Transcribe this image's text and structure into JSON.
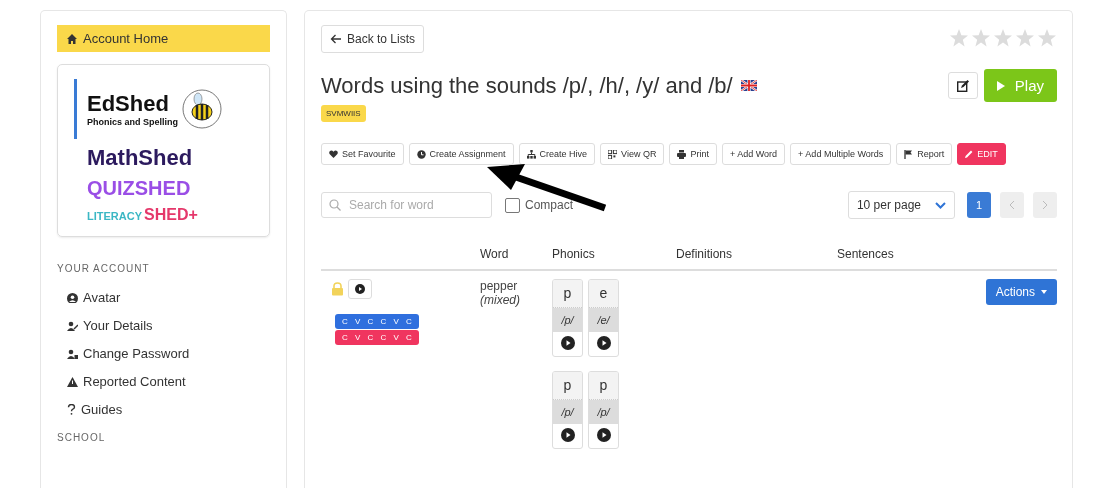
{
  "sidebar": {
    "home": {
      "label": "Account Home",
      "selected": true
    },
    "logos": [
      {
        "kind": "edshed",
        "title": "EdShed",
        "subtitle": "Phonics and Spelling",
        "selected": true
      },
      {
        "kind": "mathshed",
        "title": "MathShed",
        "selected": false
      },
      {
        "kind": "quizshed",
        "title": "QUIZSHED",
        "selected": false
      },
      {
        "kind": "literacy",
        "title": "LITERACY",
        "extra": "SHED+",
        "selected": false
      }
    ],
    "sections": [
      {
        "heading": "YOUR ACCOUNT",
        "items": [
          {
            "label": "Avatar"
          },
          {
            "label": "Your Details"
          },
          {
            "label": "Change Password"
          },
          {
            "label": "Reported Content"
          },
          {
            "label": "Guides"
          }
        ]
      },
      {
        "heading": "SCHOOL"
      }
    ]
  },
  "main": {
    "back_button": "Back to Lists",
    "stars": 0,
    "title": "Words using the sounds /p/, /h/, /y/ and /b/",
    "code": "SVMWIIS",
    "play_button": "Play",
    "toolbar": [
      {
        "label": "Set Favourite",
        "kind": "plain"
      },
      {
        "label": "Create Assignment",
        "kind": "plain"
      },
      {
        "label": "Create Hive",
        "kind": "plain"
      },
      {
        "label": "View QR",
        "kind": "plain"
      },
      {
        "label": "Print",
        "kind": "plain"
      },
      {
        "label": "+ Add Word",
        "kind": "plain"
      },
      {
        "label": "+ Add Multiple Words",
        "kind": "plain"
      },
      {
        "label": "Report",
        "kind": "plain"
      },
      {
        "label": "EDIT",
        "kind": "danger"
      }
    ],
    "search": {
      "placeholder": "Search for word"
    },
    "compact": {
      "label": "Compact",
      "checked": false
    },
    "per_page": "10 per page",
    "pagination": {
      "pages": [
        {
          "label": "1",
          "selected": true
        }
      ],
      "prev_disabled": true,
      "next_disabled": true
    },
    "table": {
      "columns": [
        "Word",
        "Phonics",
        "Definitions",
        "Sentences"
      ],
      "rows": [
        {
          "word": "pepper",
          "note": "(mixed)",
          "actions": "Actions",
          "patterns": [
            {
              "text": "C V C C V C",
              "color": "#2f6fde"
            },
            {
              "text": "C V C C V C",
              "color": "#f0355f"
            }
          ],
          "spellings": [
            [
              {
                "grapheme": "p",
                "phoneme": "/p/"
              },
              {
                "grapheme": "e",
                "phoneme": "/e/"
              }
            ],
            [
              {
                "grapheme": "p",
                "phoneme": "/p/"
              },
              {
                "grapheme": "p",
                "phoneme": "/p/"
              }
            ]
          ]
        }
      ]
    }
  }
}
